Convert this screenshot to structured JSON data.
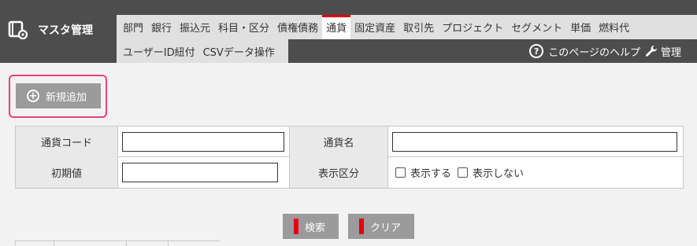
{
  "app": {
    "title": "マスタ管理"
  },
  "tabs_row1": [
    {
      "label": "部門"
    },
    {
      "label": "銀行"
    },
    {
      "label": "振込元"
    },
    {
      "label": "科目・区分"
    },
    {
      "label": "債権債務"
    },
    {
      "label": "通貨",
      "active": true
    },
    {
      "label": "固定資産"
    },
    {
      "label": "取引先"
    },
    {
      "label": "プロジェクト"
    },
    {
      "label": "セグメント"
    },
    {
      "label": "単価"
    },
    {
      "label": "燃料代"
    }
  ],
  "tabs_row2": [
    {
      "label": "ユーザーID紐付"
    },
    {
      "label": "CSVデータ操作"
    }
  ],
  "header_links": {
    "help": "このページのヘルプ",
    "admin": "管理"
  },
  "add_button": {
    "label": "新規追加"
  },
  "search_form": {
    "currency_code_label": "通貨コード",
    "currency_code_value": "",
    "currency_name_label": "通貨名",
    "currency_name_value": "",
    "initial_value_label": "初期値",
    "initial_value_value": "",
    "display_label": "表示区分",
    "show_label": "表示する",
    "hide_label": "表示しない"
  },
  "actions": {
    "search": "検索",
    "clear": "クリア"
  },
  "colors": {
    "accent_red": "#e60012",
    "highlight_pink": "#e8427a",
    "header_bg": "#4d4d4d"
  }
}
